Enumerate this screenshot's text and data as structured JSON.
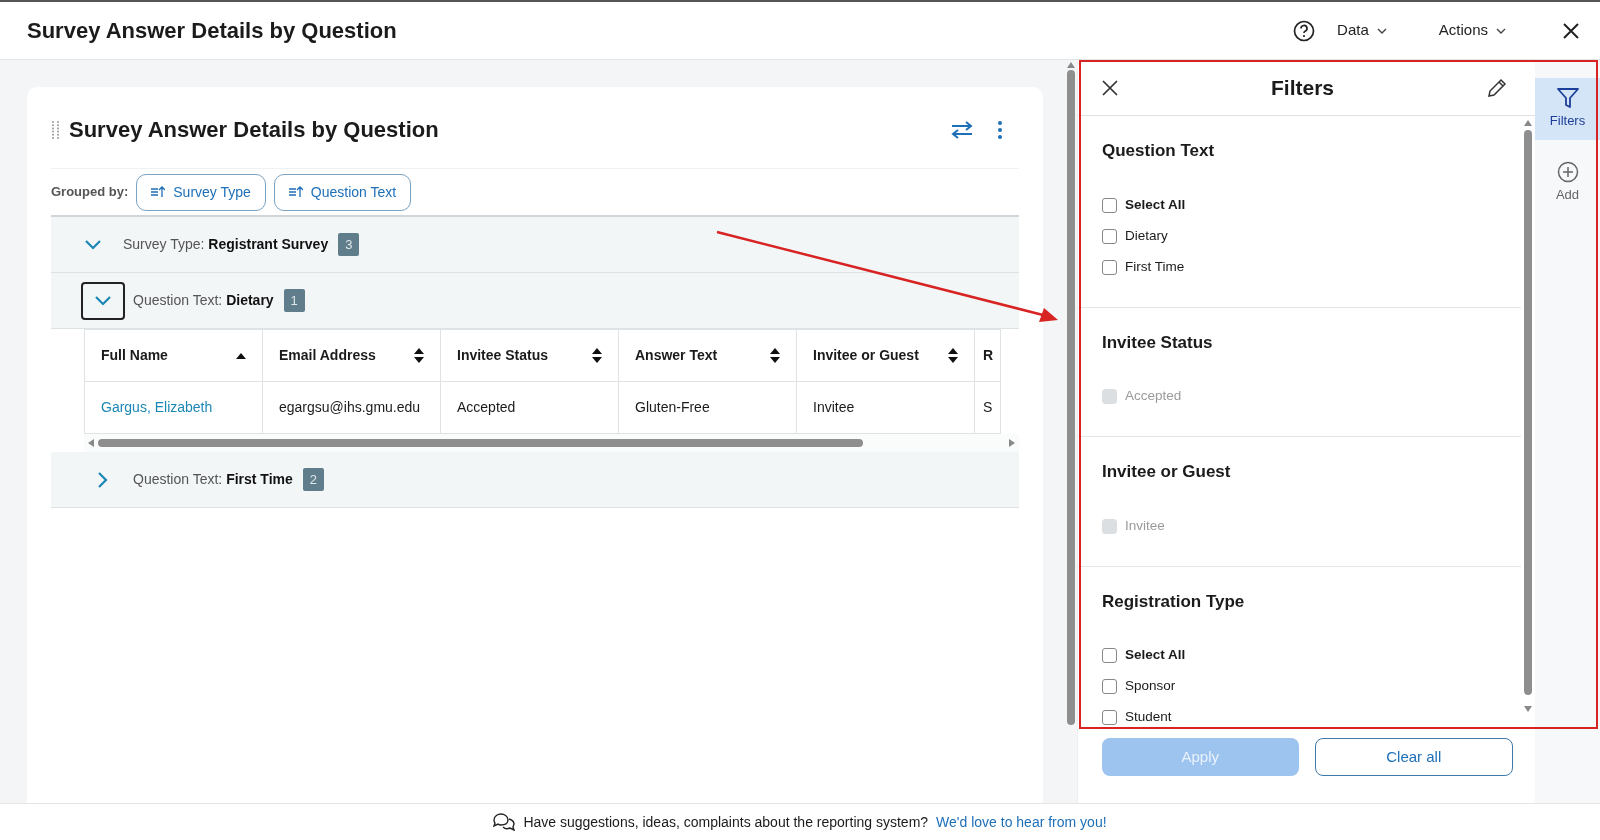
{
  "header": {
    "title": "Survey Answer Details by Question",
    "menus": [
      {
        "label": "Data"
      },
      {
        "label": "Actions"
      }
    ]
  },
  "card": {
    "title": "Survey Answer Details by Question",
    "grouped_by_label": "Grouped by:",
    "group_chips": [
      {
        "label": "Survey Type"
      },
      {
        "label": "Question Text"
      }
    ],
    "groups": [
      {
        "label": "Survey Type:",
        "value": "Registrant Survey",
        "count": "3",
        "expanded": true,
        "focused": false,
        "children": [
          {
            "label": "Question Text:",
            "value": "Dietary",
            "count": "1",
            "expanded": true,
            "focused": true,
            "table": {
              "columns": [
                {
                  "label": "Full Name",
                  "sorted": true
                },
                {
                  "label": "Email Address",
                  "sorted": false
                },
                {
                  "label": "Invitee Status",
                  "sorted": false
                },
                {
                  "label": "Answer Text",
                  "sorted": false
                },
                {
                  "label": "Invitee or Guest",
                  "sorted": false
                },
                {
                  "label": "R"
                }
              ],
              "rows": [
                [
                  {
                    "text": "Gargus, Elizabeth",
                    "kind": "link"
                  },
                  {
                    "text": "egargsu@ihs.gmu.edu",
                    "kind": "text"
                  },
                  {
                    "text": "Accepted",
                    "kind": "text"
                  },
                  {
                    "text": "Gluten-Free",
                    "kind": "text"
                  },
                  {
                    "text": "Invitee",
                    "kind": "text"
                  },
                  {
                    "text": "S",
                    "kind": "text"
                  }
                ]
              ]
            }
          },
          {
            "label": "Question Text:",
            "value": "First Time",
            "count": "2",
            "expanded": false,
            "focused": false
          }
        ]
      }
    ]
  },
  "filters": {
    "title": "Filters",
    "sections": [
      {
        "title": "Question Text",
        "options": [
          {
            "label": "Select All",
            "kind": "select_all",
            "checked": false,
            "disabled": false
          },
          {
            "label": "Dietary",
            "kind": "option",
            "checked": false,
            "disabled": false
          },
          {
            "label": "First Time",
            "kind": "option",
            "checked": false,
            "disabled": false
          }
        ]
      },
      {
        "title": "Invitee Status",
        "options": [
          {
            "label": "Accepted",
            "kind": "option",
            "checked": false,
            "disabled": true
          }
        ]
      },
      {
        "title": "Invitee or Guest",
        "options": [
          {
            "label": "Invitee",
            "kind": "option",
            "checked": false,
            "disabled": true
          }
        ]
      },
      {
        "title": "Registration Type",
        "options": [
          {
            "label": "Select All",
            "kind": "select_all",
            "checked": false,
            "disabled": false
          },
          {
            "label": "Sponsor",
            "kind": "option",
            "checked": false,
            "disabled": false
          },
          {
            "label": "Student",
            "kind": "option",
            "checked": false,
            "disabled": false
          }
        ]
      }
    ],
    "buttons": [
      {
        "label": "Apply",
        "kind": "primary",
        "disabled": true
      },
      {
        "label": "Clear all",
        "kind": "outline",
        "disabled": false
      }
    ]
  },
  "rail": [
    {
      "label": "Filters",
      "kind": "filter",
      "selected": true
    },
    {
      "label": "Add",
      "kind": "add",
      "selected": false
    }
  ],
  "footer": {
    "text": "Have suggestions, ideas, complaints about the reporting system?",
    "link": "We'd love to hear from you!"
  }
}
